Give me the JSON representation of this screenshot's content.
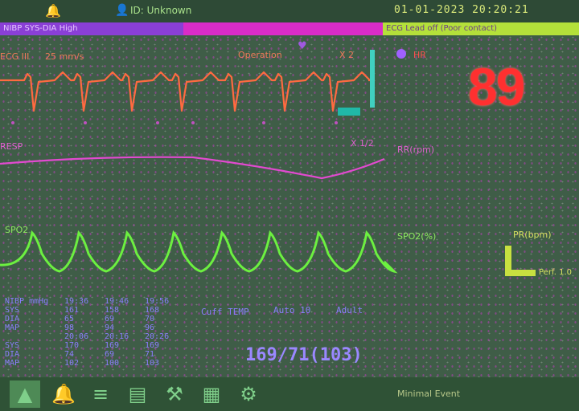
{
  "topbar": {
    "bell_icon": "bell-icon",
    "person_icon": "person-icon",
    "patient_id": "ID: Unknown",
    "clock": "01-01-2023  20:20:21"
  },
  "alarms": {
    "left": "NIBP SYS-DIA High",
    "right": "ECG Lead off (Poor contact)"
  },
  "ecg": {
    "lead": "ECG III",
    "speed": "25 mm/s",
    "mode": "Operation",
    "gain": "X 2",
    "hr_label": "HR",
    "hr_value": "89"
  },
  "resp": {
    "label": "RESP",
    "gain": "X 1/2",
    "rr_label": "RR(rpm)"
  },
  "spo2": {
    "label": "SPO2",
    "value_label": "SPO2(%)",
    "pr_label": "PR(bpm)",
    "perf": "Perf.  1.0"
  },
  "nibp": {
    "header": [
      "NIBP mmHg",
      "19:36",
      "19:46",
      "19:56"
    ],
    "rows1": [
      {
        "label": "SYS",
        "values": [
          "161",
          "158",
          "168"
        ]
      },
      {
        "label": "DIA",
        "values": [
          "65",
          "69",
          "70"
        ]
      },
      {
        "label": "MAP",
        "values": [
          "98",
          "94",
          "96"
        ]
      }
    ],
    "header2": [
      "",
      "20:06",
      "20:16",
      "20:26"
    ],
    "rows2": [
      {
        "label": "SYS",
        "values": [
          "170",
          "169",
          "169"
        ]
      },
      {
        "label": "DIA",
        "values": [
          "74",
          "69",
          "71"
        ]
      },
      {
        "label": "MAP",
        "values": [
          "102",
          "100",
          "103"
        ]
      }
    ],
    "cuff_temp": "Cuff  TEMP",
    "interval": "Auto 10",
    "adult": "Adult",
    "current": "169/71(103)"
  },
  "bottombar": {
    "tools": [
      "alarm-icon",
      "bell-icon",
      "trend-icon",
      "review-icon",
      "tools-icon",
      "record-icon",
      "settings-icon"
    ],
    "event": "Minimal Event"
  },
  "colors": {
    "ecg": "#ff6a40",
    "resp": "#e24ad0",
    "spo2": "#6cf040",
    "hr": "#ff3030",
    "nibp": "#8c7cff"
  }
}
